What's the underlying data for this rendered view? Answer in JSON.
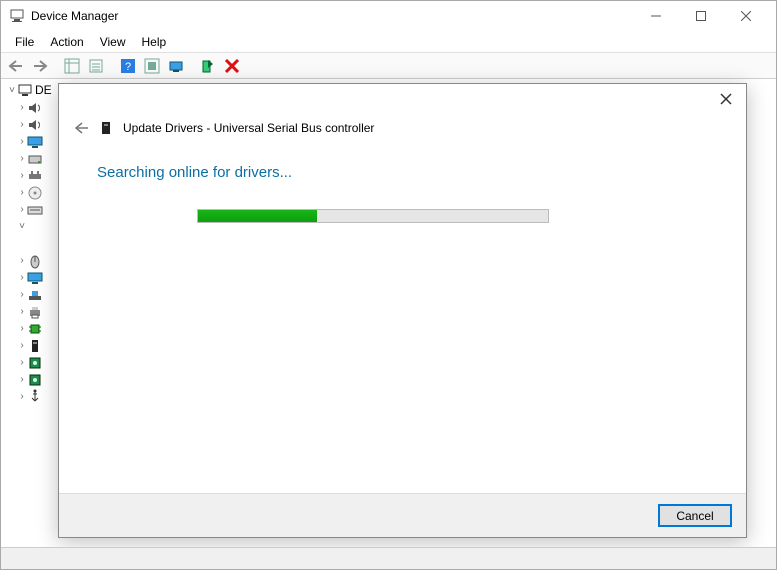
{
  "window": {
    "title": "Device Manager"
  },
  "menu": {
    "file": "File",
    "action": "Action",
    "view": "View",
    "help": "Help"
  },
  "tree": {
    "root_label": "DE",
    "items": [
      {
        "icon": "sound-icon",
        "expand": ">"
      },
      {
        "icon": "sound-icon",
        "expand": ">"
      },
      {
        "icon": "monitor-icon",
        "expand": ">"
      },
      {
        "icon": "drive-icon",
        "expand": ">"
      },
      {
        "icon": "usb-hub-icon",
        "expand": ">"
      },
      {
        "icon": "cd-icon",
        "expand": ">"
      },
      {
        "icon": "keyboard-icon",
        "expand": ">"
      },
      {
        "icon": "blank-icon",
        "expand": "v"
      },
      {
        "icon": "blank-icon",
        "expand": " "
      },
      {
        "icon": "mouse-icon",
        "expand": ">"
      },
      {
        "icon": "monitor-icon",
        "expand": ">"
      },
      {
        "icon": "net-icon",
        "expand": ">"
      },
      {
        "icon": "printer-icon",
        "expand": ">"
      },
      {
        "icon": "cpu-icon",
        "expand": ">"
      },
      {
        "icon": "device-icon",
        "expand": ">"
      },
      {
        "icon": "chip-icon",
        "expand": ">"
      },
      {
        "icon": "chip-icon",
        "expand": ">"
      },
      {
        "icon": "usb-icon",
        "expand": ">"
      }
    ]
  },
  "dialog": {
    "title": "Update Drivers - Universal Serial Bus controller",
    "status": "Searching online for drivers...",
    "progress_percent": 34,
    "cancel_label": "Cancel"
  }
}
